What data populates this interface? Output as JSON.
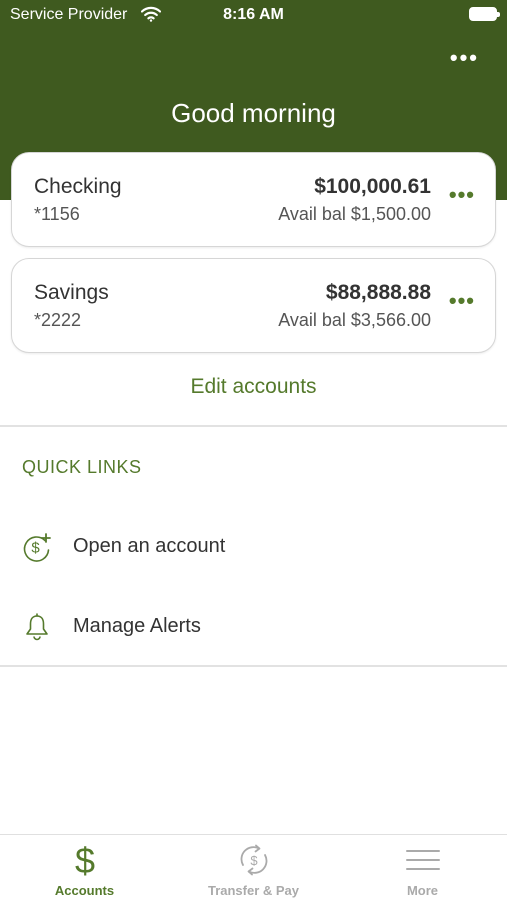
{
  "status_bar": {
    "carrier": "Service Provider",
    "time": "8:16 AM",
    "wifi_icon": "wifi-icon",
    "battery_icon": "battery-icon"
  },
  "header": {
    "greeting": "Good morning",
    "more_icon": "more-horizontal-icon",
    "background_color": "#3f5a1f"
  },
  "accounts": [
    {
      "name": "Checking",
      "number": "*1156",
      "balance": "$100,000.61",
      "available": "Avail bal $1,500.00",
      "more_icon": "more-horizontal-icon"
    },
    {
      "name": "Savings",
      "number": "*2222",
      "balance": "$88,888.88",
      "available": "Avail bal $3,566.00",
      "more_icon": "more-horizontal-icon"
    }
  ],
  "edit_accounts_label": "Edit accounts",
  "quick_links": {
    "title": "QUICK LINKS",
    "items": [
      {
        "label": "Open an account",
        "icon": "dollar-plus-icon"
      },
      {
        "label": "Manage Alerts",
        "icon": "bell-icon"
      }
    ]
  },
  "tab_bar": {
    "active_color": "#557a2c",
    "inactive_color": "#aaaaaa",
    "tabs": [
      {
        "label": "Accounts",
        "icon": "dollar-icon",
        "active": true
      },
      {
        "label": "Transfer & Pay",
        "icon": "transfer-dollar-icon",
        "active": false
      },
      {
        "label": "More",
        "icon": "menu-icon",
        "active": false
      }
    ]
  }
}
